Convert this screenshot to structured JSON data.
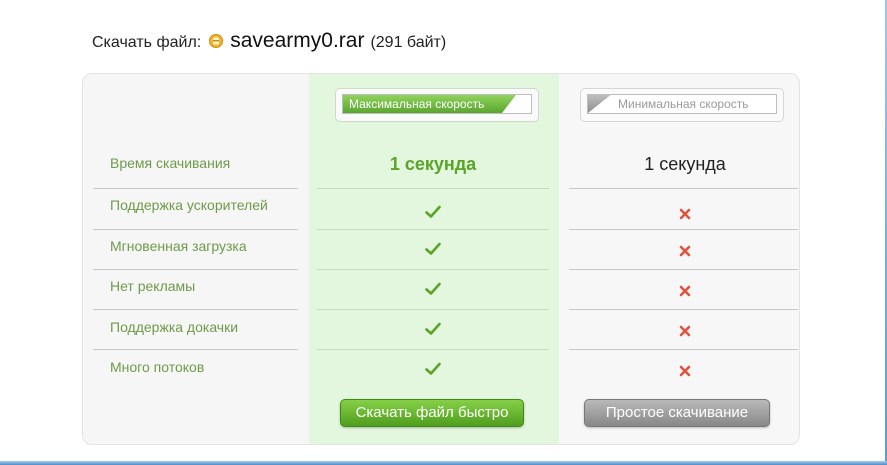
{
  "header": {
    "prefix": "Скачать файл:",
    "file_name": "savearmy0.rar",
    "file_size": "(291 байт)"
  },
  "speed": {
    "fast_label": "Максимальная скорость",
    "fast_fill": 0.92,
    "slow_label": "Минимальная скорость",
    "slow_fill": 0.12
  },
  "rows": [
    {
      "feature": "Время скачивания",
      "fast": "1 секунда",
      "slow": "1 секунда"
    },
    {
      "feature": "Поддержка ускорителей",
      "fast": "check",
      "slow": "cross"
    },
    {
      "feature": "Мгновенная загрузка",
      "fast": "check",
      "slow": "cross"
    },
    {
      "feature": "Нет рекламы",
      "fast": "check",
      "slow": "cross"
    },
    {
      "feature": "Поддержка докачки",
      "fast": "check",
      "slow": "cross"
    },
    {
      "feature": "Много потоков",
      "fast": "check",
      "slow": "cross"
    }
  ],
  "buttons": {
    "fast": "Скачать файл быстро",
    "slow": "Простое скачивание"
  },
  "colors": {
    "accent_green": "#5aa428",
    "feature_text": "#6f9a4a",
    "fast_column_bg": "#e3f6de",
    "cross_red": "#e0533d"
  }
}
